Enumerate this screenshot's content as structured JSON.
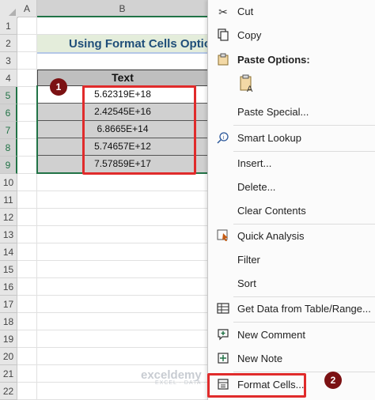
{
  "columns": [
    "A",
    "B"
  ],
  "rows": [
    "1",
    "2",
    "3",
    "4",
    "5",
    "6",
    "7",
    "8",
    "9",
    "10",
    "11",
    "12",
    "13",
    "14",
    "15",
    "16",
    "17",
    "18",
    "19",
    "20",
    "21",
    "22"
  ],
  "sheet": {
    "title": "Using Format Cells Option",
    "header": "Text",
    "values": [
      "5.62319E+18",
      "2.42545E+16",
      "6.8665E+14",
      "5.74657E+12",
      "7.57859E+17"
    ]
  },
  "callouts": [
    "1",
    "2"
  ],
  "context_menu": {
    "items": [
      {
        "label": "Cut",
        "icon": "scissors-icon"
      },
      {
        "label": "Copy",
        "icon": "copy-icon"
      },
      {
        "label": "Paste Options:",
        "icon": "clipboard-icon"
      },
      {
        "label": "Paste Special...",
        "icon": ""
      },
      {
        "label": "Smart Lookup",
        "icon": "smart-lookup-icon"
      },
      {
        "label": "Insert...",
        "icon": ""
      },
      {
        "label": "Delete...",
        "icon": ""
      },
      {
        "label": "Clear Contents",
        "icon": ""
      },
      {
        "label": "Quick Analysis",
        "icon": "quick-analysis-icon"
      },
      {
        "label": "Filter",
        "icon": ""
      },
      {
        "label": "Sort",
        "icon": ""
      },
      {
        "label": "Get Data from Table/Range...",
        "icon": "table-icon"
      },
      {
        "label": "New Comment",
        "icon": "new-comment-icon"
      },
      {
        "label": "New Note",
        "icon": "new-note-icon"
      },
      {
        "label": "Format Cells...",
        "icon": "format-cells-icon"
      }
    ]
  },
  "watermark": {
    "name": "exceldemy",
    "tagline": "EXCEL · DATA · BI"
  },
  "colors": {
    "accent": "#217346",
    "highlight": "#e02b2b",
    "badge": "#7b1113",
    "title_fill": "#e4eddb"
  }
}
